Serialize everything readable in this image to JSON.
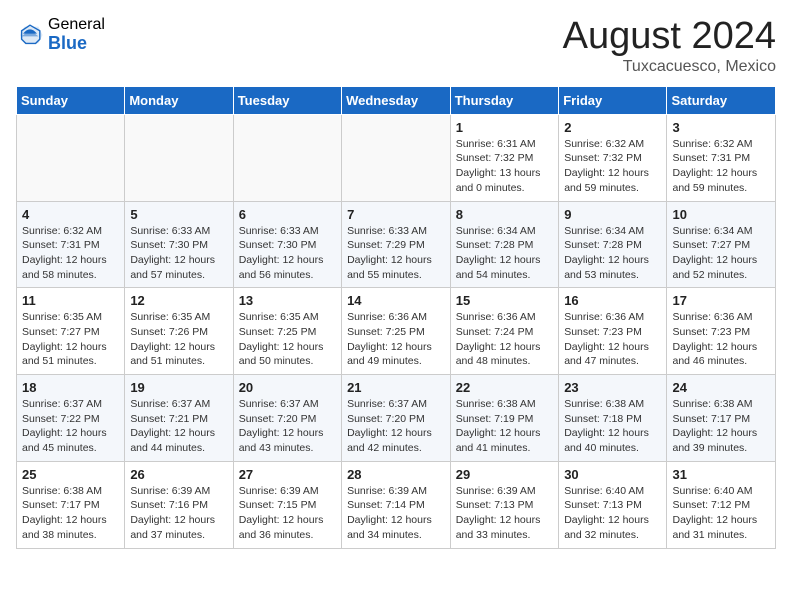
{
  "header": {
    "logo_general": "General",
    "logo_blue": "Blue",
    "title": "August 2024",
    "location": "Tuxcacuesco, Mexico"
  },
  "weekdays": [
    "Sunday",
    "Monday",
    "Tuesday",
    "Wednesday",
    "Thursday",
    "Friday",
    "Saturday"
  ],
  "weeks": [
    [
      {
        "day": "",
        "info": ""
      },
      {
        "day": "",
        "info": ""
      },
      {
        "day": "",
        "info": ""
      },
      {
        "day": "",
        "info": ""
      },
      {
        "day": "1",
        "info": "Sunrise: 6:31 AM\nSunset: 7:32 PM\nDaylight: 13 hours\nand 0 minutes."
      },
      {
        "day": "2",
        "info": "Sunrise: 6:32 AM\nSunset: 7:32 PM\nDaylight: 12 hours\nand 59 minutes."
      },
      {
        "day": "3",
        "info": "Sunrise: 6:32 AM\nSunset: 7:31 PM\nDaylight: 12 hours\nand 59 minutes."
      }
    ],
    [
      {
        "day": "4",
        "info": "Sunrise: 6:32 AM\nSunset: 7:31 PM\nDaylight: 12 hours\nand 58 minutes."
      },
      {
        "day": "5",
        "info": "Sunrise: 6:33 AM\nSunset: 7:30 PM\nDaylight: 12 hours\nand 57 minutes."
      },
      {
        "day": "6",
        "info": "Sunrise: 6:33 AM\nSunset: 7:30 PM\nDaylight: 12 hours\nand 56 minutes."
      },
      {
        "day": "7",
        "info": "Sunrise: 6:33 AM\nSunset: 7:29 PM\nDaylight: 12 hours\nand 55 minutes."
      },
      {
        "day": "8",
        "info": "Sunrise: 6:34 AM\nSunset: 7:28 PM\nDaylight: 12 hours\nand 54 minutes."
      },
      {
        "day": "9",
        "info": "Sunrise: 6:34 AM\nSunset: 7:28 PM\nDaylight: 12 hours\nand 53 minutes."
      },
      {
        "day": "10",
        "info": "Sunrise: 6:34 AM\nSunset: 7:27 PM\nDaylight: 12 hours\nand 52 minutes."
      }
    ],
    [
      {
        "day": "11",
        "info": "Sunrise: 6:35 AM\nSunset: 7:27 PM\nDaylight: 12 hours\nand 51 minutes."
      },
      {
        "day": "12",
        "info": "Sunrise: 6:35 AM\nSunset: 7:26 PM\nDaylight: 12 hours\nand 51 minutes."
      },
      {
        "day": "13",
        "info": "Sunrise: 6:35 AM\nSunset: 7:25 PM\nDaylight: 12 hours\nand 50 minutes."
      },
      {
        "day": "14",
        "info": "Sunrise: 6:36 AM\nSunset: 7:25 PM\nDaylight: 12 hours\nand 49 minutes."
      },
      {
        "day": "15",
        "info": "Sunrise: 6:36 AM\nSunset: 7:24 PM\nDaylight: 12 hours\nand 48 minutes."
      },
      {
        "day": "16",
        "info": "Sunrise: 6:36 AM\nSunset: 7:23 PM\nDaylight: 12 hours\nand 47 minutes."
      },
      {
        "day": "17",
        "info": "Sunrise: 6:36 AM\nSunset: 7:23 PM\nDaylight: 12 hours\nand 46 minutes."
      }
    ],
    [
      {
        "day": "18",
        "info": "Sunrise: 6:37 AM\nSunset: 7:22 PM\nDaylight: 12 hours\nand 45 minutes."
      },
      {
        "day": "19",
        "info": "Sunrise: 6:37 AM\nSunset: 7:21 PM\nDaylight: 12 hours\nand 44 minutes."
      },
      {
        "day": "20",
        "info": "Sunrise: 6:37 AM\nSunset: 7:20 PM\nDaylight: 12 hours\nand 43 minutes."
      },
      {
        "day": "21",
        "info": "Sunrise: 6:37 AM\nSunset: 7:20 PM\nDaylight: 12 hours\nand 42 minutes."
      },
      {
        "day": "22",
        "info": "Sunrise: 6:38 AM\nSunset: 7:19 PM\nDaylight: 12 hours\nand 41 minutes."
      },
      {
        "day": "23",
        "info": "Sunrise: 6:38 AM\nSunset: 7:18 PM\nDaylight: 12 hours\nand 40 minutes."
      },
      {
        "day": "24",
        "info": "Sunrise: 6:38 AM\nSunset: 7:17 PM\nDaylight: 12 hours\nand 39 minutes."
      }
    ],
    [
      {
        "day": "25",
        "info": "Sunrise: 6:38 AM\nSunset: 7:17 PM\nDaylight: 12 hours\nand 38 minutes."
      },
      {
        "day": "26",
        "info": "Sunrise: 6:39 AM\nSunset: 7:16 PM\nDaylight: 12 hours\nand 37 minutes."
      },
      {
        "day": "27",
        "info": "Sunrise: 6:39 AM\nSunset: 7:15 PM\nDaylight: 12 hours\nand 36 minutes."
      },
      {
        "day": "28",
        "info": "Sunrise: 6:39 AM\nSunset: 7:14 PM\nDaylight: 12 hours\nand 34 minutes."
      },
      {
        "day": "29",
        "info": "Sunrise: 6:39 AM\nSunset: 7:13 PM\nDaylight: 12 hours\nand 33 minutes."
      },
      {
        "day": "30",
        "info": "Sunrise: 6:40 AM\nSunset: 7:13 PM\nDaylight: 12 hours\nand 32 minutes."
      },
      {
        "day": "31",
        "info": "Sunrise: 6:40 AM\nSunset: 7:12 PM\nDaylight: 12 hours\nand 31 minutes."
      }
    ]
  ]
}
